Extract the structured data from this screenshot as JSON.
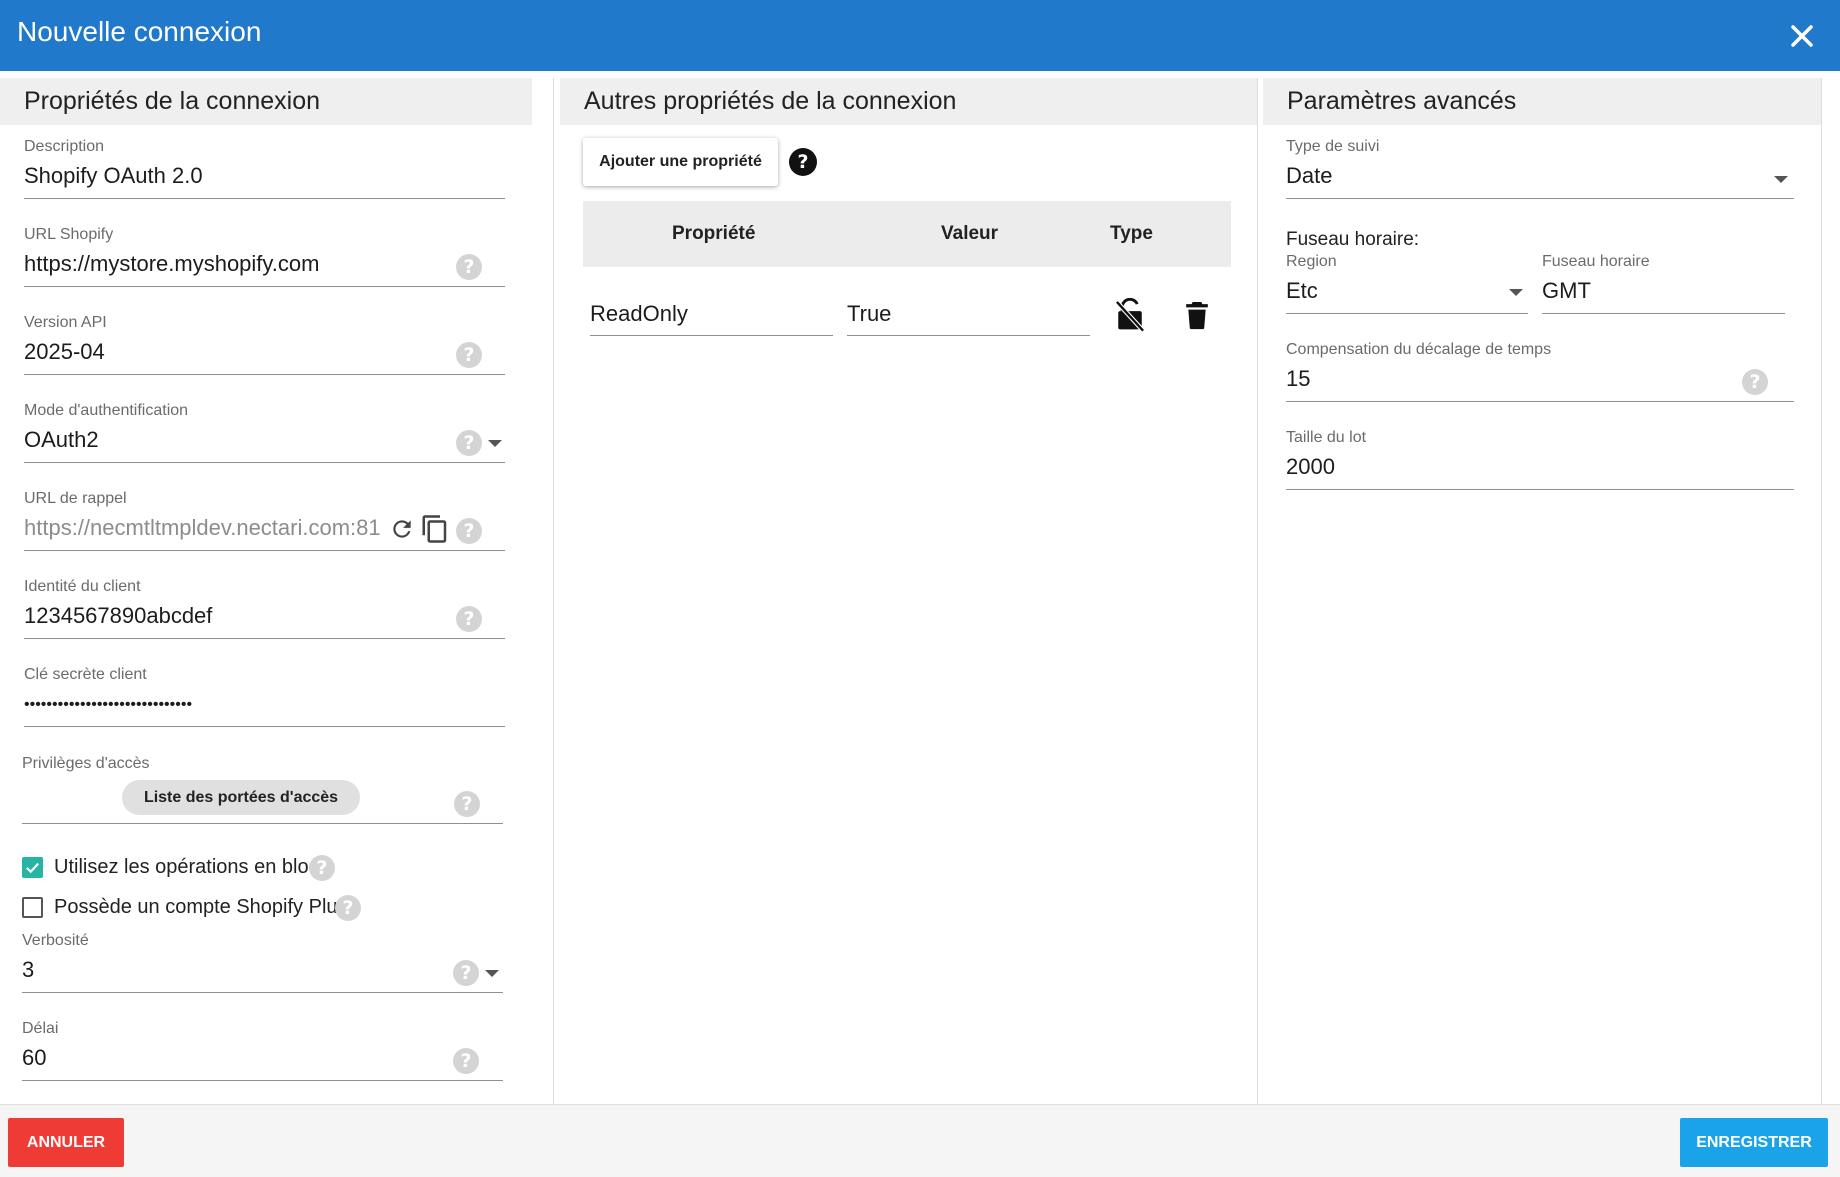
{
  "dialog": {
    "title": "Nouvelle connexion"
  },
  "sections": {
    "left": "Propriétés de la connexion",
    "middle": "Autres propriétés de la connexion",
    "right": "Paramètres avancés"
  },
  "left": {
    "description": {
      "label": "Description",
      "value": "Shopify OAuth 2.0"
    },
    "shopify_url": {
      "label": "URL Shopify",
      "value": "https://mystore.myshopify.com"
    },
    "api_version": {
      "label": "Version API",
      "value": "2025-04"
    },
    "auth_mode": {
      "label": "Mode d'authentification",
      "value": "OAuth2"
    },
    "callback_url": {
      "label": "URL de rappel",
      "value": "https://necmtltmpldev.nectari.com:81"
    },
    "client_id": {
      "label": "Identité du client",
      "value": "1234567890abcdef"
    },
    "client_secret": {
      "label": "Clé secrète client",
      "value": "••••••••••••••••••••••••••••••"
    },
    "access": {
      "label": "Privilèges d'accès",
      "button": "Liste des portées d'accès"
    },
    "bulk_ops": {
      "label": "Utilisez les opérations en bloc",
      "checked": true
    },
    "shopify_plus": {
      "label": "Possède un compte Shopify Plus",
      "checked": false
    },
    "verbosity": {
      "label": "Verbosité",
      "value": "3"
    },
    "delay": {
      "label": "Délai",
      "value": "60"
    }
  },
  "middle": {
    "add_button": "Ajouter une propriété",
    "help": "?",
    "columns": [
      "Propriété",
      "Valeur",
      "Type"
    ],
    "rows": [
      {
        "property": "ReadOnly",
        "value": "True"
      }
    ]
  },
  "right": {
    "tracking_type": {
      "label": "Type de suivi",
      "value": "Date"
    },
    "timezone_title": "Fuseau horaire:",
    "region": {
      "label": "Region",
      "value": "Etc"
    },
    "timezone": {
      "label": "Fuseau horaire",
      "value": "GMT"
    },
    "time_offset": {
      "label": "Compensation du décalage de temps",
      "value": "15"
    },
    "batch_size": {
      "label": "Taille du lot",
      "value": "2000"
    }
  },
  "footer": {
    "cancel": "ANNULER",
    "save": "ENREGISTRER"
  },
  "colors": {
    "header": "#2179cb",
    "cancel": "#ee3b35",
    "save": "#1aa3e8",
    "checkbox_on": "#26b5a4"
  }
}
